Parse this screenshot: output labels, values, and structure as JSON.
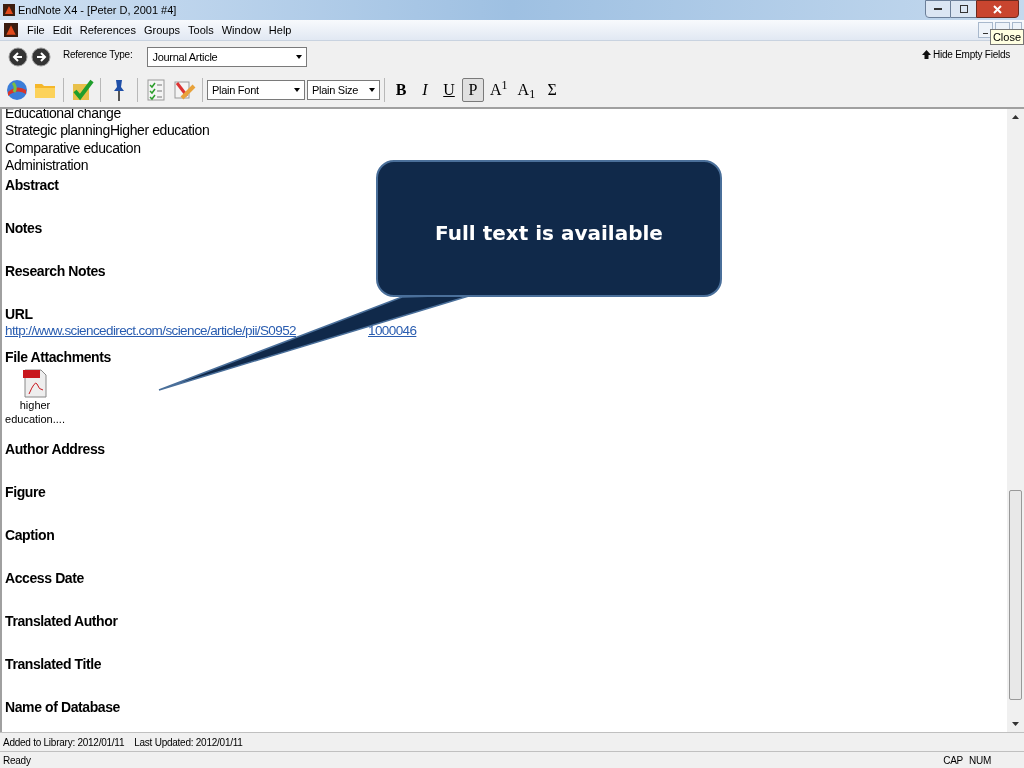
{
  "window": {
    "title": "EndNote X4 - [Peter D, 2001 #4]"
  },
  "menu": [
    "File",
    "Edit",
    "References",
    "Groups",
    "Tools",
    "Window",
    "Help"
  ],
  "tooltip": "Close",
  "reference_type": {
    "label": "Reference Type:",
    "value": "Journal Article"
  },
  "hide_empty": "Hide Empty Fields",
  "font": "Plain Font",
  "size": "Plain Size",
  "format_buttons": [
    {
      "label": "B",
      "kind": "bold",
      "selected": false
    },
    {
      "label": "I",
      "kind": "italic",
      "selected": false
    },
    {
      "label": "U",
      "kind": "underline",
      "selected": false
    },
    {
      "label": "P",
      "kind": "plain",
      "selected": true
    },
    {
      "label": "A$^{1}$",
      "kind": "plain",
      "selected": false
    },
    {
      "label": "A$_{1}$",
      "kind": "plain",
      "selected": false
    },
    {
      "label": "Σ",
      "kind": "plain",
      "selected": false
    }
  ],
  "keywords": [
    "Educational change",
    "Strategic planningHigher education",
    "Comparative education",
    "Administration"
  ],
  "fields": [
    {
      "label": "Abstract",
      "kind": "empty"
    },
    {
      "label": "Notes",
      "kind": "empty"
    },
    {
      "label": "Research Notes",
      "kind": "empty"
    },
    {
      "label": "URL",
      "kind": "link",
      "value_start": "http://www.sciencedirect.com/science/article/pii/S0952",
      "value_end": "1000046"
    },
    {
      "label": "File Attachments",
      "kind": "attachment",
      "file": "higher education...."
    },
    {
      "label": "Author Address",
      "kind": "empty"
    },
    {
      "label": "Figure",
      "kind": "empty"
    },
    {
      "label": "Caption",
      "kind": "empty"
    },
    {
      "label": "Access Date",
      "kind": "empty"
    },
    {
      "label": "Translated Author",
      "kind": "empty"
    },
    {
      "label": "Translated Title",
      "kind": "empty"
    },
    {
      "label": "Name of Database",
      "kind": "empty"
    }
  ],
  "callout": "Full text is available",
  "info_bar": {
    "added": "Added to Library: 2012/01/11",
    "updated": "Last Updated: 2012/01/11"
  },
  "status_bar": {
    "text": "Ready",
    "cap": "CAP",
    "num": "NUM"
  }
}
